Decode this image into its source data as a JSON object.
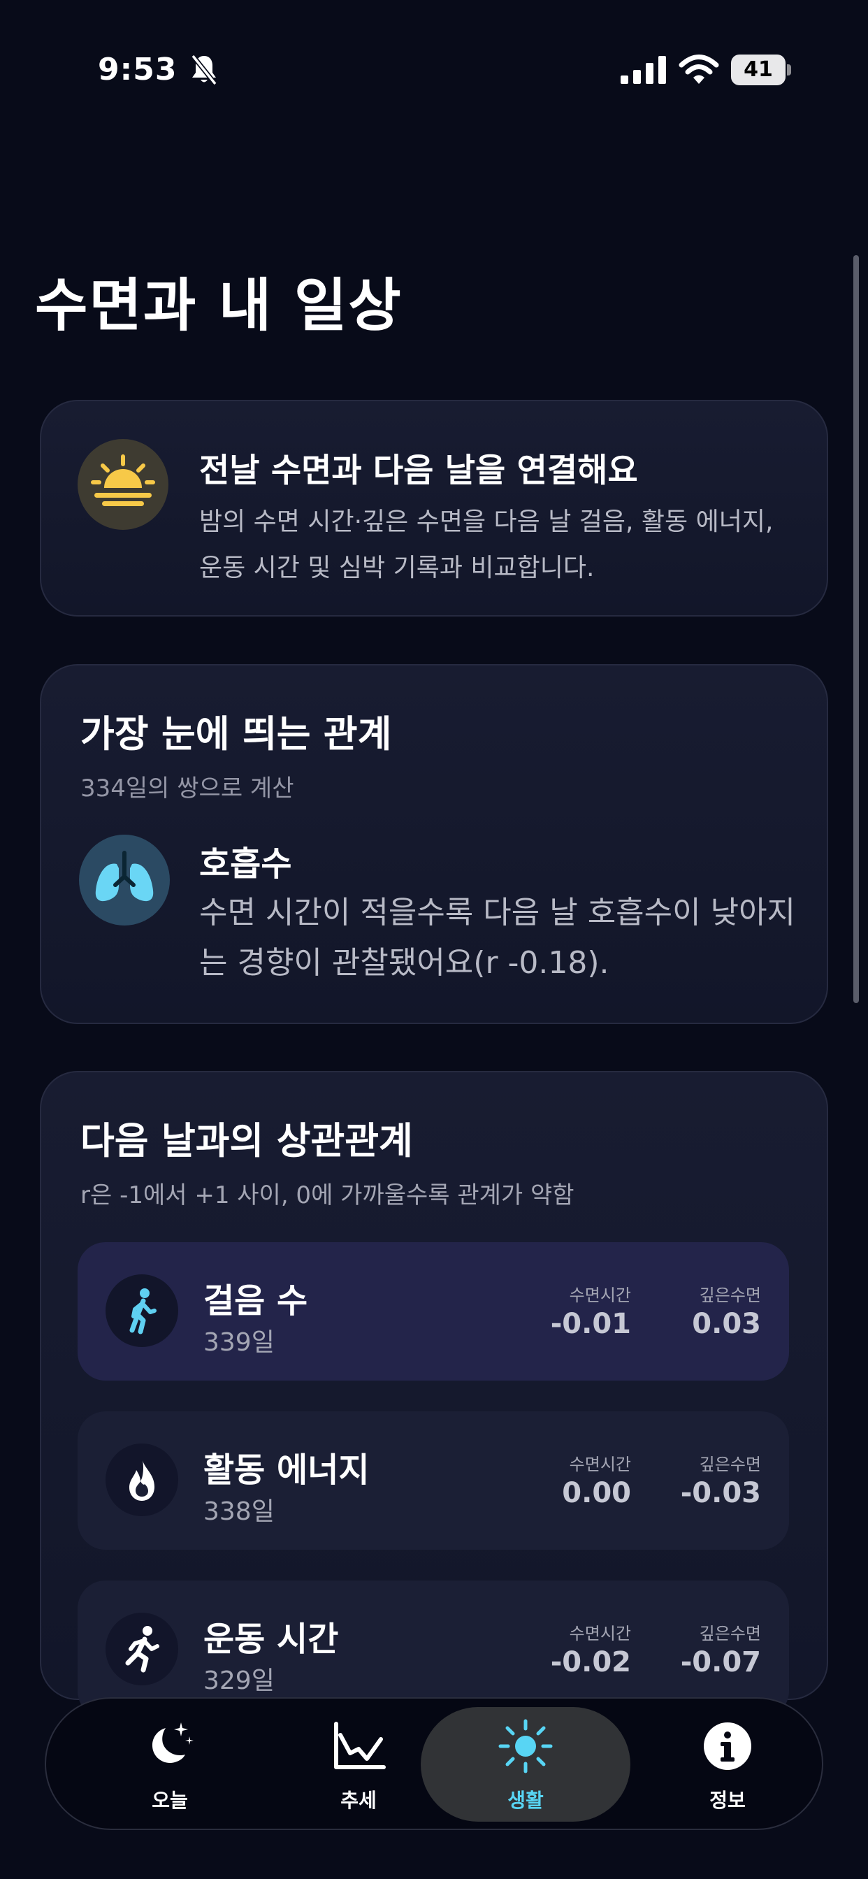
{
  "status_bar": {
    "time": "9:53",
    "battery": "41"
  },
  "page": {
    "title": "수면과 내 일상"
  },
  "intro_card": {
    "icon": "sunrise-icon",
    "title": "전날 수면과 다음 날을 연결해요",
    "description": "밤의 수면 시간·깊은 수면을 다음 날 걸음, 활동 에너지, 운동 시간 및 심박 기록과 비교합니다."
  },
  "top_relation": {
    "title": "가장 눈에 띄는 관계",
    "subtitle": "334일의 쌍으로 계산",
    "icon": "lungs-icon",
    "metric": "호흡수",
    "description": "수면 시간이 적을수록 다음 날 호흡수이 낮아지는 경향이 관찰됐어요(r -0.18)."
  },
  "correlations": {
    "title": "다음 날과의 상관관계",
    "subtitle": "r은 -1에서 +1 사이, 0에 가까울수록 관계가 약함",
    "rows": [
      {
        "icon": "walking-icon",
        "name": "걸음 수",
        "days": "339일",
        "sleep_time_label": "수면시간",
        "sleep_time": "-0.01",
        "deep_sleep_label": "깊은수면",
        "deep_sleep": "0.03",
        "selected": true
      },
      {
        "icon": "flame-icon",
        "name": "활동 에너지",
        "days": "338일",
        "sleep_time_label": "수면시간",
        "sleep_time": "0.00",
        "deep_sleep_label": "깊은수면",
        "deep_sleep": "-0.03",
        "selected": false
      },
      {
        "icon": "running-icon",
        "name": "운동 시간",
        "days": "329일",
        "sleep_time_label": "수면시간",
        "sleep_time": "-0.02",
        "deep_sleep_label": "깊은수면",
        "deep_sleep": "-0.07",
        "selected": false
      }
    ]
  },
  "tab_bar": {
    "tabs": [
      {
        "icon": "moon-stars-icon",
        "label": "오늘",
        "active": false
      },
      {
        "icon": "trend-chart-icon",
        "label": "추세",
        "active": false
      },
      {
        "icon": "sun-icon",
        "label": "생활",
        "active": true
      },
      {
        "icon": "info-icon",
        "label": "정보",
        "active": false
      }
    ]
  },
  "colors": {
    "background": "#080b19",
    "accent": "#58d5f4",
    "sun_yellow": "#f7c948"
  }
}
